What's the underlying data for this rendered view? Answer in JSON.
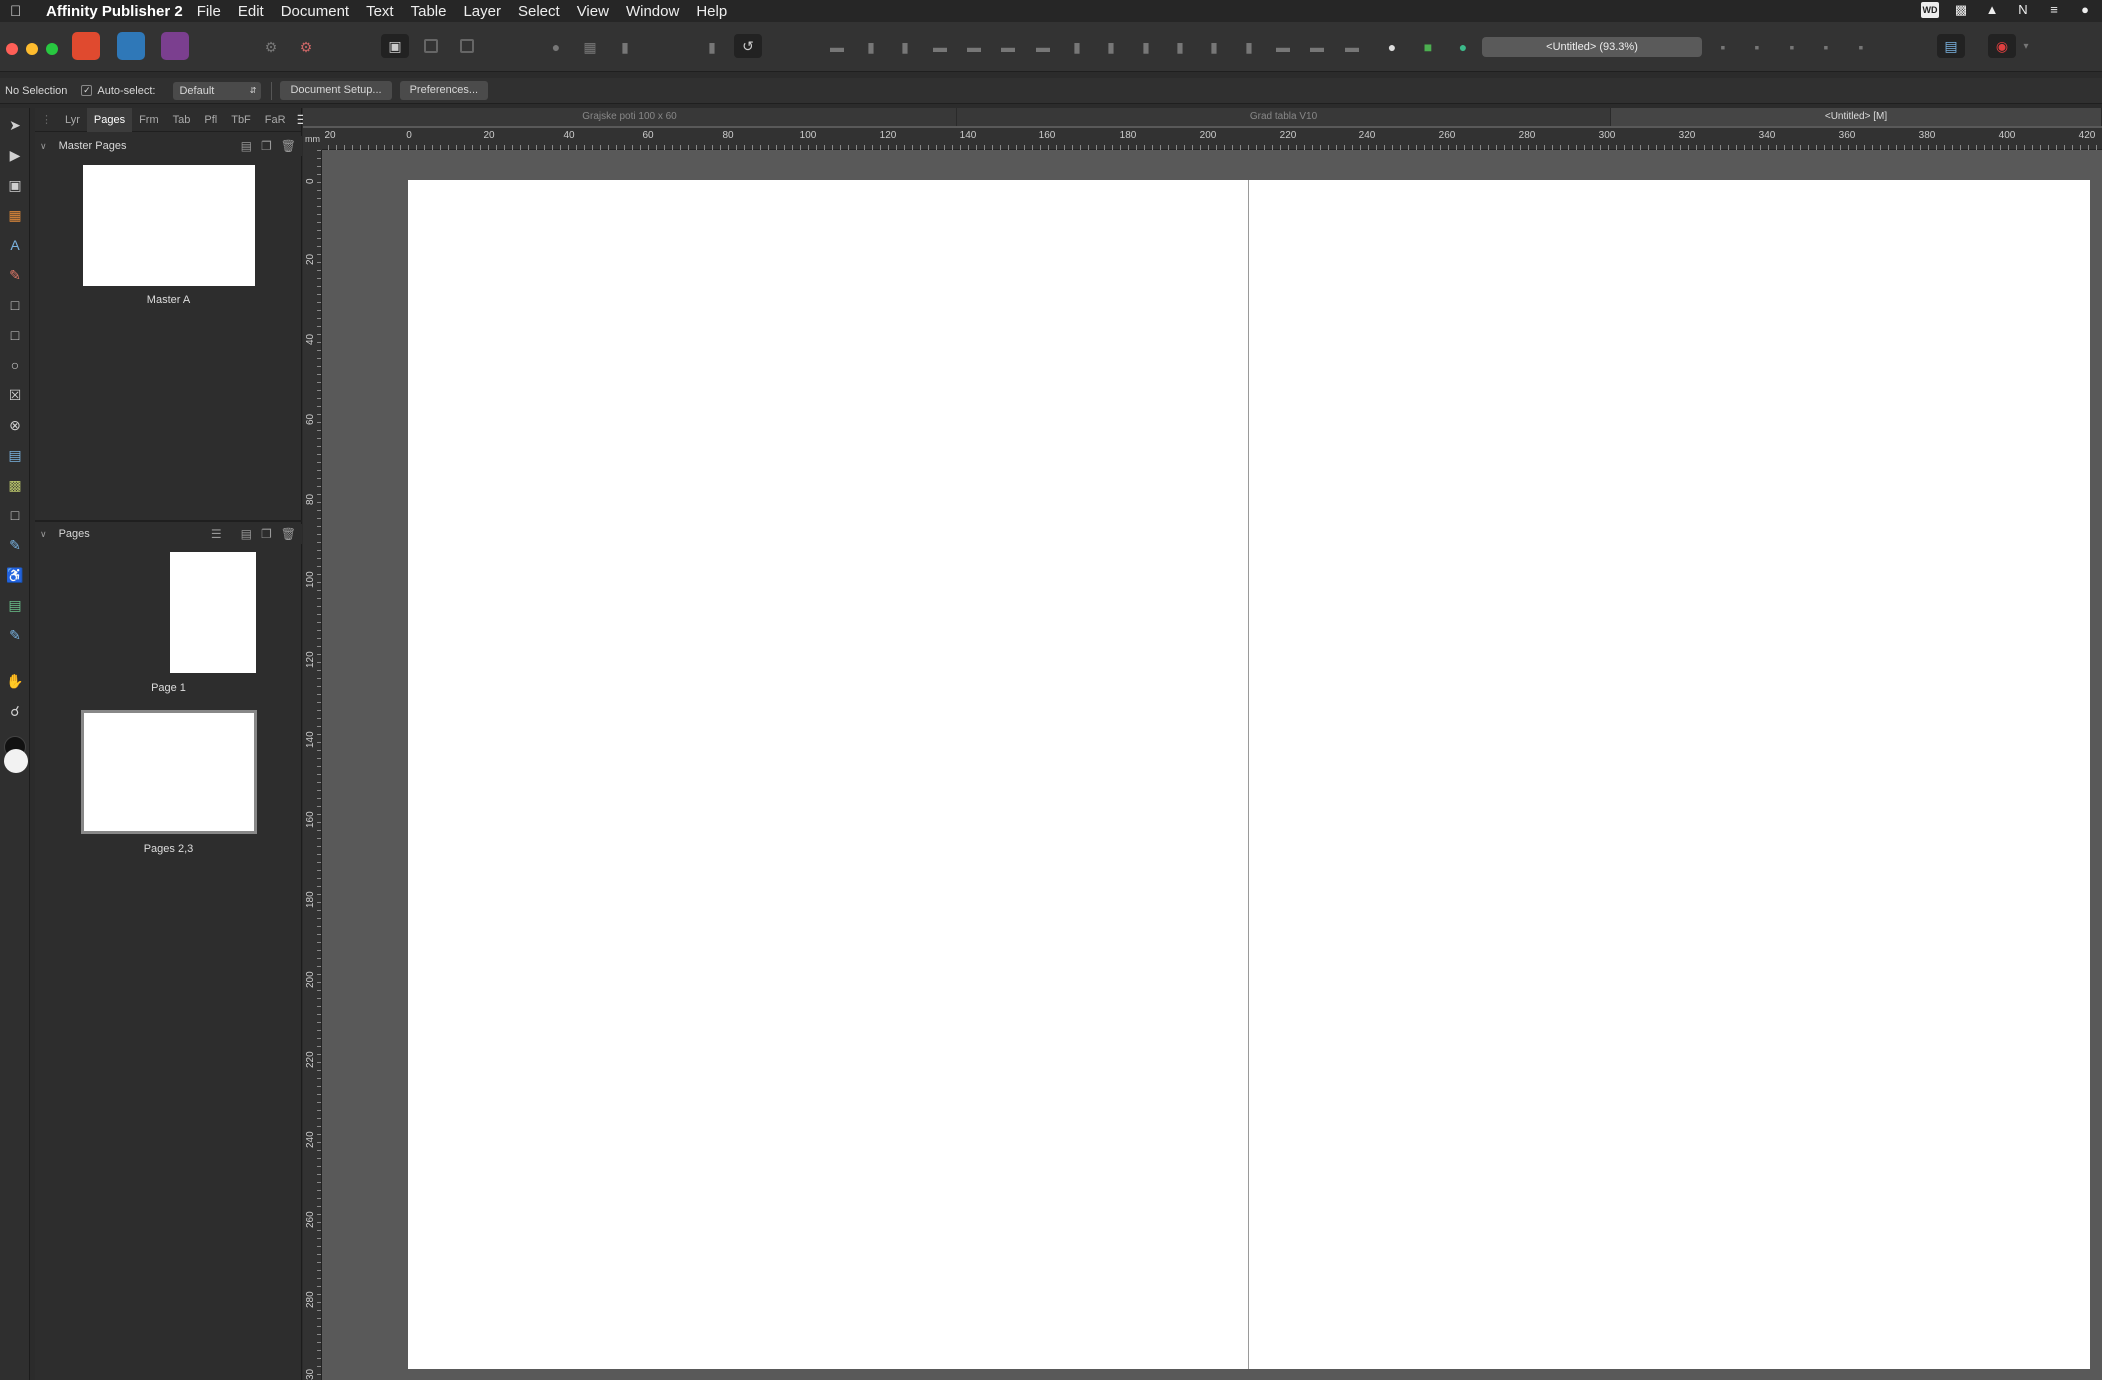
{
  "menubar": {
    "app_name": "Affinity Publisher 2",
    "items": [
      "File",
      "Edit",
      "Document",
      "Text",
      "Table",
      "Layer",
      "Select",
      "View",
      "Window",
      "Help"
    ],
    "tray_icons": [
      "wd-icon",
      "notification-icon",
      "affinity-tray-icon",
      "n-icon",
      "grid-icon",
      "creative-cloud-icon"
    ]
  },
  "toolbar": {
    "zoom_title": "<Untitled> (93.3%)",
    "personas": [
      {
        "name": "publisher-persona",
        "color": "#e04a2f"
      },
      {
        "name": "designer-persona",
        "color": "#2f78b8"
      },
      {
        "name": "photo-persona",
        "color": "#7b3f8f"
      }
    ]
  },
  "context": {
    "selection": "No Selection",
    "auto_select_label": "Auto-select:",
    "auto_select_checked": true,
    "auto_select_value": "Default",
    "document_setup": "Document Setup...",
    "preferences": "Preferences..."
  },
  "panel": {
    "tabs": [
      "Lyr",
      "Pages",
      "Frm",
      "Tab",
      "Pfl",
      "TbF",
      "FaR"
    ],
    "active_tab": "Pages",
    "master_section": "Master Pages",
    "master_label": "Master A",
    "pages_section": "Pages",
    "page1_label": "Page 1",
    "pages23_label": "Pages 2,3"
  },
  "doc_tabs": [
    "Grajske poti 100 x 60",
    "Grad tabla V10",
    "<Untitled> [M]"
  ],
  "ruler": {
    "unit": "mm",
    "h_labels": [
      "20",
      "0",
      "20",
      "40",
      "60",
      "80",
      "100",
      "120",
      "140",
      "160",
      "180",
      "200",
      "220",
      "240",
      "260",
      "280",
      "300",
      "320",
      "340",
      "360",
      "380",
      "400",
      "420"
    ],
    "v_labels": [
      "0",
      "20",
      "40",
      "60",
      "80",
      "100",
      "120",
      "140",
      "160",
      "180",
      "200",
      "220",
      "240",
      "260",
      "280",
      "30"
    ]
  }
}
